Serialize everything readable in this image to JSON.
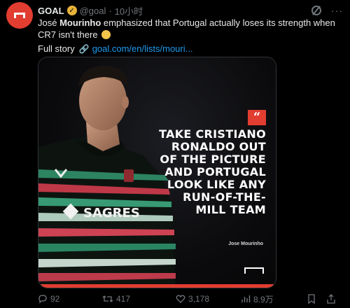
{
  "account": {
    "name": "GOAL",
    "handle": "@goal",
    "separator": "·",
    "time": "10小时",
    "verified_color": "#e8b339",
    "avatar_color": "#e23d31"
  },
  "tweet": {
    "text_pre": "José ",
    "text_bold": "Mourinho",
    "text_post": " emphasized that Portugal actually loses its strength when CR7 isn't there",
    "full_story_label": "Full story",
    "link_text": "goal.com/en/lists/mouri..."
  },
  "media": {
    "quote_mark": "“",
    "quote_text": "Take Cristiano Ronaldo out of the picture and Portugal look like any run-of-the-mill team",
    "attribution": "Jose Mourinho",
    "sponsor_text": "SAGRES",
    "accent_color": "#e23d31"
  },
  "actions": {
    "replies": "92",
    "reposts": "417",
    "likes": "3,178",
    "views": "8.9万"
  },
  "colors": {
    "background": "#000000",
    "text": "#e7e9ea",
    "muted": "#71767b",
    "link": "#1d9bf0"
  }
}
